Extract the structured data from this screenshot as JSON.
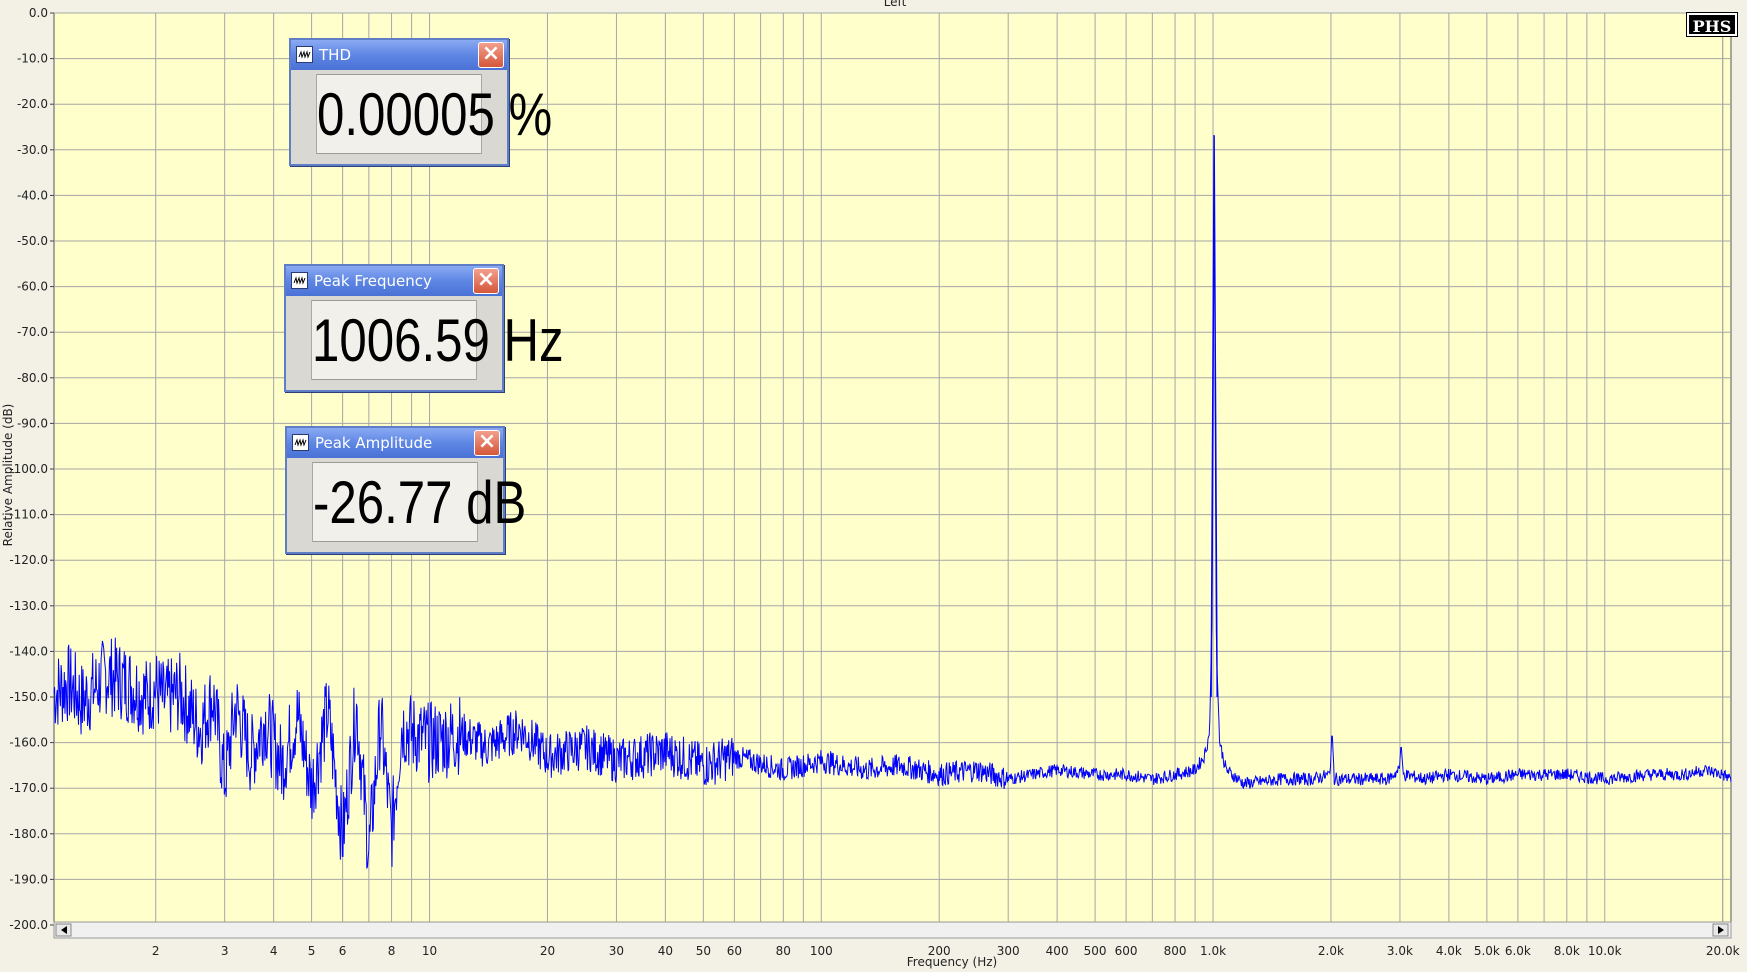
{
  "window": {
    "channel_title": "Left",
    "logo_text": "PHS"
  },
  "meters": [
    {
      "title": "THD",
      "value": "0.00005 %"
    },
    {
      "title": "Peak Frequency",
      "value": "1006.59 Hz"
    },
    {
      "title": "Peak Amplitude",
      "value": "-26.77 dB"
    }
  ],
  "colors": {
    "plot_bg": "#ffffcc",
    "trace": "#0000ff",
    "grid": "#a6a6a6"
  },
  "chart_data": {
    "type": "line",
    "title": "Left",
    "xlabel": "Frequency (Hz)",
    "ylabel": "Relative Amplitude (dB)",
    "x_scale": "log",
    "xlim": [
      1.1,
      21000
    ],
    "ylim": [
      -200,
      0
    ],
    "grid": true,
    "y_ticks": [
      "0.0",
      "-10.0",
      "-20.0",
      "-30.0",
      "-40.0",
      "-50.0",
      "-60.0",
      "-70.0",
      "-80.0",
      "-90.0",
      "-100.0",
      "-110.0",
      "-120.0",
      "-130.0",
      "-140.0",
      "-150.0",
      "-160.0",
      "-170.0",
      "-180.0",
      "-190.0",
      "-200.0"
    ],
    "x_ticks": [
      {
        "value": 2,
        "label": "2"
      },
      {
        "value": 3,
        "label": "3"
      },
      {
        "value": 4,
        "label": "4"
      },
      {
        "value": 5,
        "label": "5"
      },
      {
        "value": 6,
        "label": "6"
      },
      {
        "value": 8,
        "label": "8"
      },
      {
        "value": 10,
        "label": "10"
      },
      {
        "value": 20,
        "label": "20"
      },
      {
        "value": 30,
        "label": "30"
      },
      {
        "value": 40,
        "label": "40"
      },
      {
        "value": 50,
        "label": "50"
      },
      {
        "value": 60,
        "label": "60"
      },
      {
        "value": 80,
        "label": "80"
      },
      {
        "value": 100,
        "label": "100"
      },
      {
        "value": 200,
        "label": "200"
      },
      {
        "value": 300,
        "label": "300"
      },
      {
        "value": 400,
        "label": "400"
      },
      {
        "value": 500,
        "label": "500"
      },
      {
        "value": 600,
        "label": "600"
      },
      {
        "value": 800,
        "label": "800"
      },
      {
        "value": 1000,
        "label": "1.0k"
      },
      {
        "value": 2000,
        "label": "2.0k"
      },
      {
        "value": 3000,
        "label": "3.0k"
      },
      {
        "value": 4000,
        "label": "4.0k"
      },
      {
        "value": 5000,
        "label": "5.0k"
      },
      {
        "value": 6000,
        "label": "6.0k"
      },
      {
        "value": 8000,
        "label": "8.0k"
      },
      {
        "value": 10000,
        "label": "10.0k"
      },
      {
        "value": 20000,
        "label": "20.0k"
      }
    ],
    "series": [
      {
        "x": [
          1.1,
          1.2,
          1.3,
          1.4,
          1.5,
          1.7,
          1.9,
          2.0,
          2.1,
          2.3,
          2.6,
          2.8,
          3.0,
          3.2,
          3.5,
          3.8,
          4.2,
          4.6,
          5.0,
          5.5,
          6.0,
          6.5,
          7.0,
          7.5,
          8.0,
          8.5,
          9.0,
          10,
          12,
          14,
          17,
          20,
          25,
          30,
          40,
          50,
          60,
          80,
          100,
          130,
          160,
          200,
          250,
          300,
          400,
          500,
          600,
          700,
          800,
          900,
          950,
          980,
          995,
          1002,
          1006.59,
          1012,
          1020,
          1040,
          1080,
          1200,
          1500,
          1800,
          1990,
          2013,
          2040,
          2300,
          2800,
          2990,
          3020,
          3060,
          3500,
          4000,
          5000,
          6000,
          8000,
          10000,
          13000,
          16000,
          18000,
          20000,
          21000
        ],
        "y": [
          -149,
          -147,
          -151,
          -148,
          -145,
          -147,
          -150,
          -148,
          -151,
          -149,
          -157,
          -150,
          -168,
          -152,
          -163,
          -155,
          -165,
          -154,
          -170,
          -153,
          -181,
          -152,
          -184,
          -155,
          -180,
          -156,
          -158,
          -160,
          -158,
          -161,
          -157,
          -163,
          -161,
          -164,
          -162,
          -165,
          -163,
          -166,
          -164,
          -166,
          -165,
          -167,
          -166,
          -168,
          -166,
          -167,
          -167,
          -168,
          -167,
          -166,
          -163,
          -158,
          -130,
          -80,
          -26.77,
          -80,
          -140,
          -160,
          -166,
          -169,
          -168,
          -168,
          -167,
          -157,
          -168,
          -168,
          -168,
          -166,
          -160,
          -167,
          -168,
          -167,
          -168,
          -167,
          -167,
          -168,
          -167,
          -167,
          -166,
          -167,
          -168
        ]
      }
    ],
    "annotations": [
      "THD 0.00005 %",
      "Peak Frequency 1006.59 Hz",
      "Peak Amplitude -26.77 dB"
    ]
  }
}
